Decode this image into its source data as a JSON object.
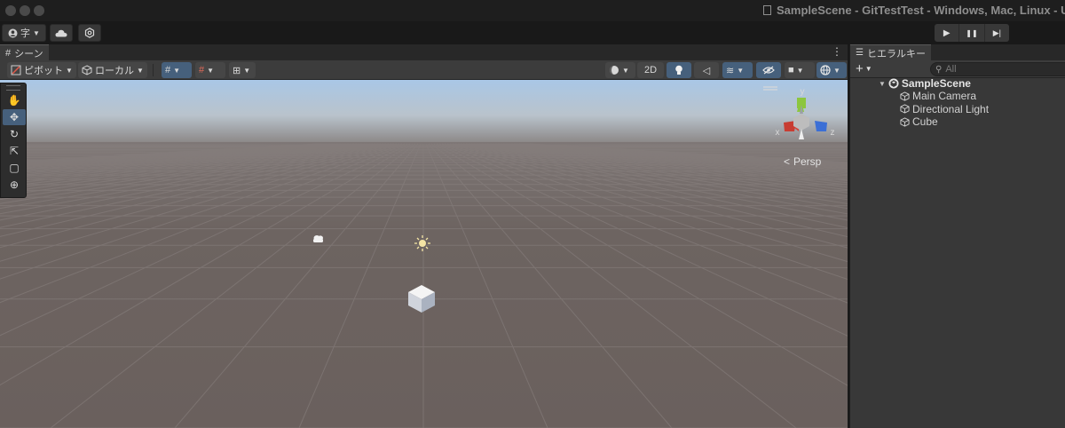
{
  "window": {
    "title": "SampleScene - GitTestTest - Windows, Mac, Linux - Unity"
  },
  "toolbar": {
    "account_label": "字",
    "cloud_icon": "cloud-icon",
    "settings_icon": "settings-icon",
    "play_icon": "▶",
    "pause_icon": "❚❚",
    "step_icon": "▶|"
  },
  "scene": {
    "tab_label": "シーン",
    "pivot_label": "ピボット",
    "local_label": "ローカル",
    "mode_2d_label": "2D",
    "persp_label": "Persp",
    "gizmo_axes": {
      "x": "x",
      "y": "y",
      "z": "z"
    }
  },
  "hierarchy": {
    "tab_label": "ヒエラルキー",
    "add_label": "+",
    "search_placeholder": "All",
    "scene_name": "SampleScene",
    "items": [
      {
        "label": "Main Camera"
      },
      {
        "label": "Directional Light"
      },
      {
        "label": "Cube"
      }
    ]
  },
  "colors": {
    "accent_blue": "#46607c",
    "axis_x": "#d4453a",
    "axis_y": "#8cc63f",
    "axis_z": "#3b6fd6",
    "ground": "#6b625f",
    "sky_top": "#a9c7e6"
  }
}
